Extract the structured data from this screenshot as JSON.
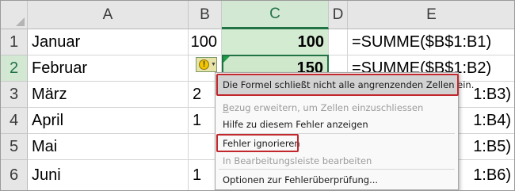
{
  "spreadsheet": {
    "columns": [
      "A",
      "B",
      "C",
      "D",
      "E"
    ],
    "active_column": "C",
    "active_row": "2",
    "rows": [
      {
        "num": "1",
        "a": "Januar",
        "b": "100",
        "c": "100",
        "e": "=SUMME($B$1:B1)"
      },
      {
        "num": "2",
        "a": "Februar",
        "b": "",
        "c": "150",
        "e": "=SUMME($B$1:B2)"
      },
      {
        "num": "3",
        "a": "März",
        "b": "2",
        "c": "",
        "e": "1:B3)"
      },
      {
        "num": "4",
        "a": "April",
        "b": "1",
        "c": "",
        "e": "1:B4)"
      },
      {
        "num": "5",
        "a": "Mai",
        "b": "",
        "c": "",
        "e": "1:B5)"
      },
      {
        "num": "6",
        "a": "Juni",
        "b": "1",
        "c": "",
        "e": "1:B6)"
      }
    ]
  },
  "error_menu": {
    "title": "Die Formel schließt nicht alle angrenzenden Zellen ein.",
    "items": [
      {
        "label": "Bezug erweitern, um Zellen einzuschliessen",
        "enabled": false
      },
      {
        "label": "Hilfe zu diesem Fehler anzeigen",
        "enabled": true
      },
      {
        "label": "Fehler ignorieren",
        "enabled": true
      },
      {
        "label": "In Bearbeitungsleiste bearbeiten",
        "enabled": false
      },
      {
        "label": "Optionen zur Fehlerüberprüfung...",
        "enabled": true
      }
    ]
  },
  "colors": {
    "accent_green": "#217346",
    "highlight_red": "#c1272d",
    "selected_cell_bg": "#d3ebd0",
    "warning_yellow": "#f2c500"
  },
  "icons": [
    "select-all-triangle-icon",
    "warning-icon",
    "dropdown-arrow-icon",
    "error-indicator-icon"
  ]
}
